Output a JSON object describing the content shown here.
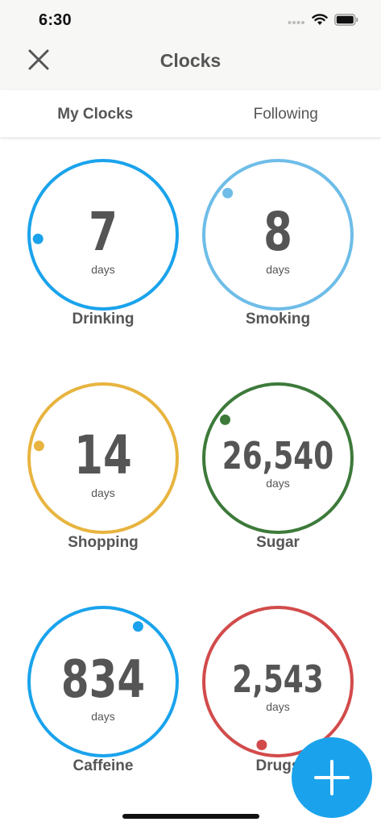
{
  "status_bar": {
    "time": "6:30",
    "icons": [
      "signal-dots-icon",
      "wifi-icon",
      "battery-icon"
    ]
  },
  "header": {
    "title": "Clocks",
    "close_icon": "close-icon"
  },
  "tabs": [
    {
      "label": "My Clocks",
      "active": true
    },
    {
      "label": "Following",
      "active": false
    }
  ],
  "clocks": [
    {
      "value": "7",
      "unit": "days",
      "name": "Drinking",
      "color": "#1aa3ec",
      "progress": 0.74
    },
    {
      "value": "8",
      "unit": "days",
      "name": "Smoking",
      "color": "#6ebde8",
      "progress": 0.86
    },
    {
      "value": "14",
      "unit": "days",
      "name": "Shopping",
      "color": "#e8b43f",
      "progress": 0.78
    },
    {
      "value": "26,540",
      "unit": "days",
      "name": "Sugar",
      "color": "#3d7a3a",
      "progress": 0.85
    },
    {
      "value": "834",
      "unit": "days",
      "name": "Caffeine",
      "color": "#1aa3ec",
      "progress": 0.09
    },
    {
      "value": "2,543",
      "unit": "days",
      "name": "Drugs",
      "color": "#d24b4b",
      "progress": 0.54
    }
  ],
  "fab": {
    "icon": "plus-icon",
    "color": "#1aa3ec"
  }
}
